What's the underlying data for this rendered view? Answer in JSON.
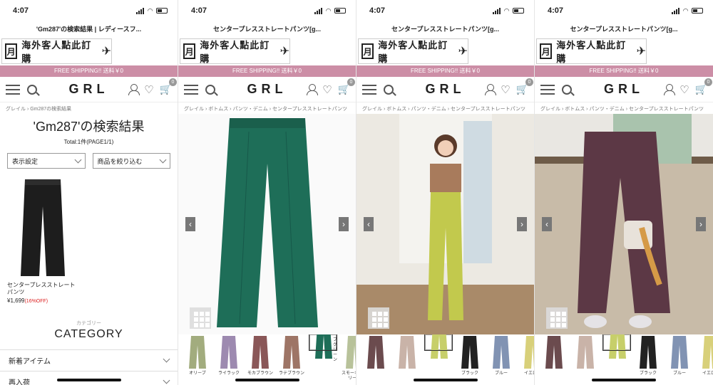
{
  "status": {
    "time": "4:07"
  },
  "common": {
    "banner_text": "海外客人點此訂購",
    "banner_logo": "月",
    "shipping": "FREE SHIPPING!! 送料￥0",
    "brand": "GRL",
    "cart_count": "0"
  },
  "panels": [
    {
      "page_title": "'Gm287'の検索結果 | レディースフ...",
      "breadcrumb": "グレイル  ›  Gm287の検索結果",
      "result_title": "'Gm287'の検索結果",
      "total": "Total:1件(PAGE1/1)",
      "sort_label": "表示設定",
      "filter_label": "商品を絞り込む",
      "product_name": "センタープレスストレートパンツ",
      "product_price": "¥1,699",
      "product_off": "(16%OFF)",
      "category_small": "カテゴリー",
      "category_big": "CATEGORY",
      "list_items": [
        "新着アイテム",
        "再入荷"
      ]
    },
    {
      "page_title": "センタープレスストレートパンツ[g...",
      "breadcrumb": "グレイル  ›  ボトムス  ›  パンツ・デニム  ›  センタープレスストレートパンツ"
    },
    {
      "page_title": "センタープレスストレートパンツ[g...",
      "breadcrumb": "グレイル  ›  ボトムス  ›  パンツ・デニム  ›  センタープレスストレートパンツ"
    },
    {
      "page_title": "センタープレスストレートパンツ[g...",
      "breadcrumb": "グレイル  ›  ボトムス  ›  パンツ・デニム  ›  センタープレスストレートパンツ"
    }
  ],
  "color_thumbs": [
    {
      "label": "オリーブ",
      "color": "#a2ac7e"
    },
    {
      "label": "ライラック",
      "color": "#9d8ab0"
    },
    {
      "label": "モカブラウン",
      "color": "#8a5758"
    },
    {
      "label": "ラテブラウン",
      "color": "#9e7566"
    },
    {
      "label": "ディープグリーン",
      "color": "#1e6e58"
    },
    {
      "label": "スモーキーグリーン",
      "color": "#b8c29a"
    }
  ],
  "model_thumbs": [
    {
      "label": "",
      "color": "#6b4b4e"
    },
    {
      "label": "",
      "color": "#c9b3a8"
    },
    {
      "label": "",
      "color": "#c7cf6a"
    },
    {
      "label": "ブラック",
      "color": "#222222"
    },
    {
      "label": "ブルー",
      "color": "#8193b3"
    },
    {
      "label": "イエロー",
      "color": "#d8d07a"
    }
  ],
  "colors": {
    "ship_bar": "#cc8ea6",
    "black_pants": "#1d1d1d",
    "green_pants": "#1e6e58",
    "lime_pants": "#c2c94d",
    "plum_pants": "#5c3845"
  }
}
